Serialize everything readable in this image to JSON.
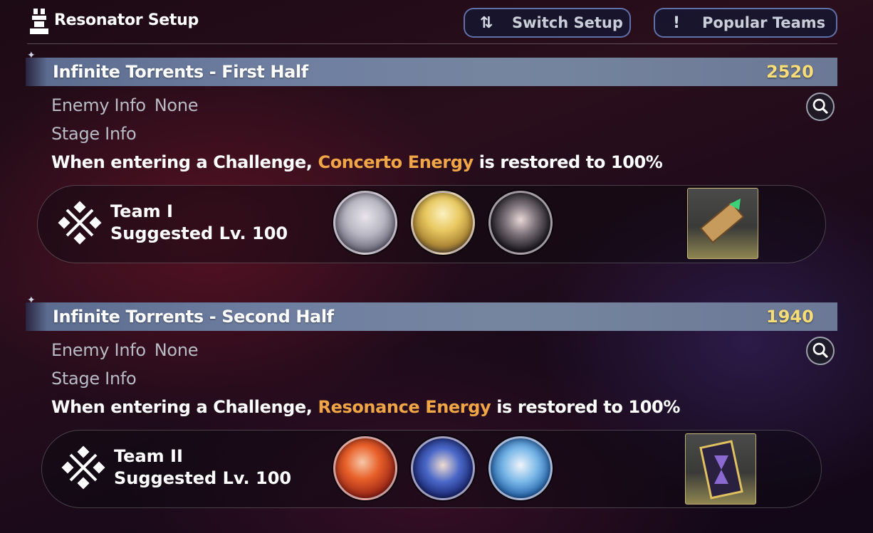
{
  "header": {
    "title": "Resonator Setup",
    "switch_label": "Switch Setup",
    "popular_label": "Popular Teams"
  },
  "stages": [
    {
      "title": "Infinite Torrents - First Half",
      "score": "2520",
      "enemy_label": "Enemy Info",
      "enemy_value": "None",
      "stage_label": "Stage Info",
      "desc_prefix": "When entering a Challenge,",
      "desc_highlight": "Concerto Energy",
      "desc_suffix": "is restored to 100%",
      "team_name": "Team I",
      "team_level": "Suggested Lv. 100"
    },
    {
      "title": "Infinite Torrents - Second Half",
      "score": "1940",
      "enemy_label": "Enemy Info",
      "enemy_value": "None",
      "stage_label": "Stage Info",
      "desc_prefix": "When entering a Challenge,",
      "desc_highlight": "Resonance Energy",
      "desc_suffix": "is restored to 100%",
      "team_name": "Team II",
      "team_level": "Suggested Lv. 100"
    }
  ],
  "colors": {
    "score": "#f6dd78",
    "highlight": "#f0a646",
    "bar": "#6e7ea0"
  },
  "icons": [
    "resonator-icon",
    "switch-icon",
    "exclamation-icon",
    "search-icon",
    "team-emblem-icon",
    "character-avatar",
    "echo-icon"
  ]
}
